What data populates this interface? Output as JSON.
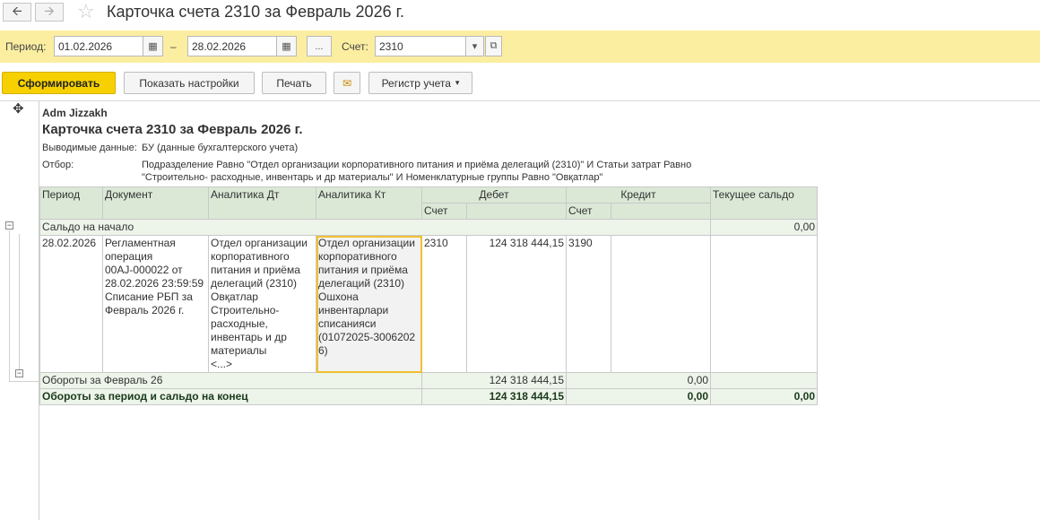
{
  "window": {
    "title": "Карточка счета 2310 за Февраль 2026 г."
  },
  "filter": {
    "period_label": "Период:",
    "date_from": "01.02.2026",
    "dash": "–",
    "date_to": "28.02.2026",
    "ellipsis": "...",
    "account_label": "Счет:",
    "account": "2310"
  },
  "toolbar": {
    "generate": "Сформировать",
    "show_settings": "Показать настройки",
    "print": "Печать",
    "registry": "Регистр учета"
  },
  "report": {
    "org": "Adm Jizzakh",
    "heading": "Карточка счета 2310 за Февраль 2026 г.",
    "output_label": "Выводимые данные:",
    "output_value": "БУ (данные бухгалтерского учета)",
    "filter_label": "Отбор:",
    "filter_line1": "Подразделение Равно \"Отдел организации корпоративного питания и приёма делегаций (2310)\" И Статьи затрат Равно",
    "filter_line2": "\"Строительно- расходные, инвентарь и др материалы\" И Номенклатурные группы Равно \"Овқатлар\""
  },
  "table": {
    "headers": {
      "period": "Период",
      "document": "Документ",
      "analytics_dt": "Аналитика Дт",
      "analytics_kt": "Аналитика Кт",
      "debit": "Дебет",
      "credit": "Кредит",
      "balance": "Текущее сальдо",
      "account": "Счет"
    },
    "opening": {
      "label": "Сальдо на начало",
      "balance": "0,00"
    },
    "row": {
      "date": "28.02.2026",
      "document": [
        "Регламентная",
        "операция",
        "00AJ-000022 от",
        "28.02.2026 23:59:59",
        "Списание РБП за",
        "Февраль 2026 г."
      ],
      "analytics_dt": [
        "Отдел организации",
        "корпоративного",
        "питания и приёма",
        "делегаций (2310)",
        "Овқатлар",
        "Строительно-",
        "расходные,",
        "инвентарь и др",
        "материалы",
        "<...>"
      ],
      "analytics_kt": [
        "Отдел организации",
        "корпоративного",
        "питания и приёма",
        "делегаций (2310)",
        "Ошхона",
        "инвентарлари",
        "списанияси",
        "(01072025-3006202",
        "6)"
      ],
      "debit_account": "2310",
      "debit_amount": "124 318 444,15",
      "credit_account": "3190"
    },
    "turnover": {
      "label": "Обороты за Февраль 26",
      "debit": "124 318 444,15",
      "credit": "0,00"
    },
    "total": {
      "label": "Обороты за период и сальдо на конец",
      "debit": "124 318 444,15",
      "credit": "0,00",
      "balance": "0,00"
    }
  }
}
